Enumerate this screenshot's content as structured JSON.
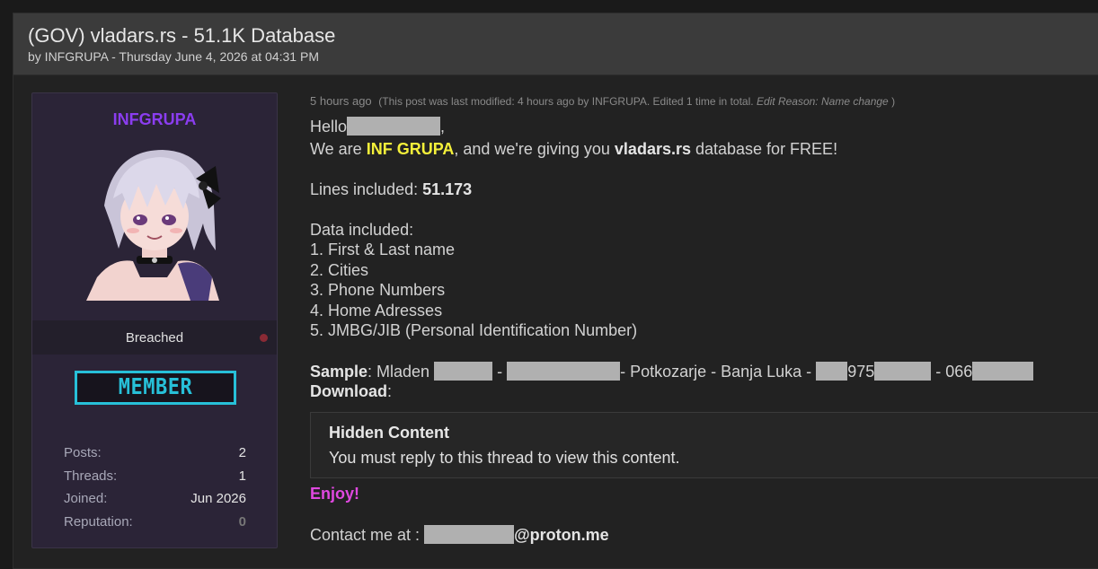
{
  "thread": {
    "title": "(GOV) vladars.rs - 51.1K Database",
    "meta": "by INFGRUPA - Thursday June 4, 2026 at 04:31 PM"
  },
  "author": {
    "name": "INFGRUPA",
    "rank": "Breached",
    "badge": "MEMBER",
    "stats": [
      {
        "label": "Posts:",
        "value": "2"
      },
      {
        "label": "Threads:",
        "value": "1"
      },
      {
        "label": "Joined:",
        "value": "Jun 2026"
      },
      {
        "label": "Reputation:",
        "value": "0"
      }
    ]
  },
  "post": {
    "time": "5 hours ago",
    "modified_prefix": "(This post was last modified: 4 hours ago by INFGRUPA. Edited 1 time in total.",
    "edit_reason_label": "Edit Reason:",
    "edit_reason": "Name change",
    "modified_suffix": ")",
    "hello": "Hello",
    "hello_suffix": ",",
    "intro_1": "We are ",
    "intro_group": "INF GRUPA",
    "intro_2": ", and we're giving you ",
    "intro_site": "vladars.rs",
    "intro_3": " database for FREE!",
    "lines_label": "Lines included: ",
    "lines_value": "51.173",
    "data_header": "Data included:",
    "data_items": [
      "1. First & Last name",
      "2. Cities",
      "3. Phone Numbers",
      "4. Home Adresses",
      "5. JMBG/JIB (Personal Identification Number)"
    ],
    "sample_label": "Sample",
    "sample_parts": {
      "colon": ": Mladen ",
      "sep1": " - ",
      "place": "- Potkozarje - Banja Luka - ",
      "id_digits": "975",
      "sep2": " - 066"
    },
    "download_label": "Download",
    "download_colon": ":",
    "hidden_title": "Hidden Content",
    "hidden_text": "You must reply to this thread to view this content.",
    "enjoy": "Enjoy!",
    "contact_label": "Contact me at : ",
    "contact_domain": "@proton.me"
  },
  "colors": {
    "accent_purple": "#8b3df0",
    "badge_cyan": "#27c0d8",
    "highlight_yellow": "#f4f03a",
    "enjoy_pink": "#e048e0"
  }
}
